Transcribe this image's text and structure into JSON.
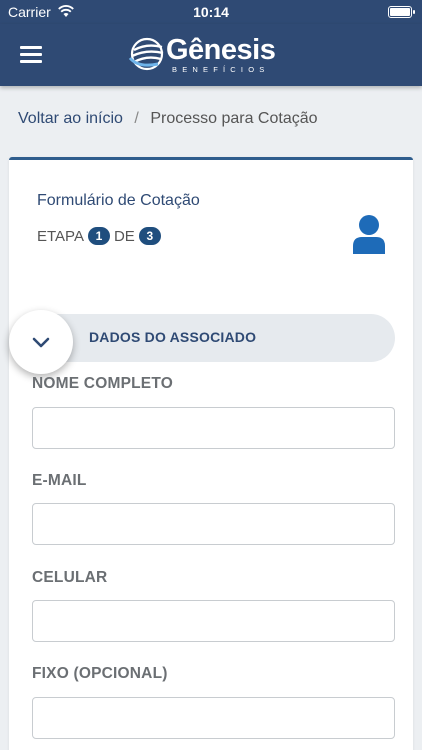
{
  "status_bar": {
    "carrier": "Carrier",
    "time": "10:14"
  },
  "nav": {
    "logo_name": "Gênesis",
    "logo_sub": "BENEFÍCIOS"
  },
  "breadcrumb": {
    "home": "Voltar ao início",
    "separator": "/",
    "current": "Processo para Cotação"
  },
  "form": {
    "title": "Formulário de Cotação",
    "step_prefix": "ETAPA",
    "step_current": "1",
    "step_of": "DE",
    "step_total": "3",
    "section_title": "DADOS DO ASSOCIADO",
    "fields": [
      {
        "label": "NOME COMPLETO",
        "value": ""
      },
      {
        "label": "E-MAIL",
        "value": ""
      },
      {
        "label": "CELULAR",
        "value": ""
      },
      {
        "label": "FIXO (OPCIONAL)",
        "value": ""
      }
    ]
  },
  "colors": {
    "brand_navy": "#2f4a74",
    "badge_blue": "#1f4e7e",
    "accent_blue": "#1e6bb8"
  },
  "icons": {
    "menu": "hamburger-menu-icon",
    "user": "user-icon",
    "collapse": "chevron-down-icon",
    "wifi": "wifi-icon",
    "battery": "battery-icon"
  }
}
